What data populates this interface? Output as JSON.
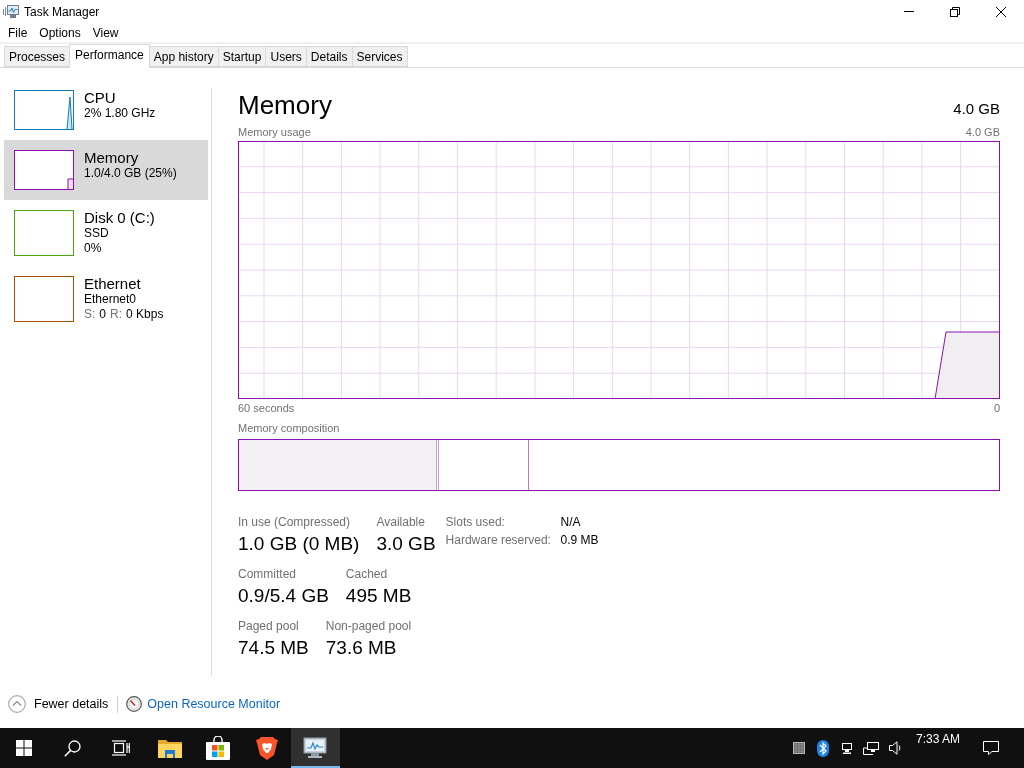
{
  "window": {
    "title": "Task Manager"
  },
  "menu": [
    {
      "label": "File"
    },
    {
      "label": "Options"
    },
    {
      "label": "View"
    }
  ],
  "tabs": [
    {
      "label": "Processes",
      "selected": false
    },
    {
      "label": "Performance",
      "selected": true
    },
    {
      "label": "App history",
      "selected": false
    },
    {
      "label": "Startup",
      "selected": false
    },
    {
      "label": "Users",
      "selected": false
    },
    {
      "label": "Details",
      "selected": false
    },
    {
      "label": "Services",
      "selected": false
    }
  ],
  "sidebar": {
    "items": [
      {
        "kind": "cpu",
        "name": "CPU",
        "details": [
          "2% 1.80 GHz"
        ],
        "color": "#117dbb",
        "selected": false
      },
      {
        "kind": "memory",
        "name": "Memory",
        "details": [
          "1.0/4.0 GB (25%)"
        ],
        "color": "#8b12ae",
        "selected": true
      },
      {
        "kind": "disk",
        "name": "Disk 0 (C:)",
        "details": [
          "SSD",
          "0%"
        ],
        "color": "#4da60c",
        "selected": false
      },
      {
        "kind": "network",
        "name": "Ethernet",
        "details": [
          "Ethernet0"
        ],
        "rates": [
          {
            "label": "S:",
            "value": "0"
          },
          {
            "label": "R:",
            "value": "0 Kbps"
          }
        ],
        "color": "#a74f01",
        "selected": false
      }
    ]
  },
  "panel": {
    "title": "Memory",
    "capacity": "4.0 GB",
    "usage_graph": {
      "label": "Memory usage",
      "max_label": "4.0 GB",
      "start_label": "60 seconds",
      "end_label": "0"
    },
    "composition": {
      "label": "Memory composition"
    },
    "stat_rows": [
      [
        {
          "label": "In use (Compressed)",
          "value": "1.0 GB (0 MB)"
        },
        {
          "label": "Available",
          "value": "3.0 GB"
        }
      ],
      [
        {
          "label": "Committed",
          "value": "0.9/5.4 GB"
        },
        {
          "label": "Cached",
          "value": "495 MB"
        }
      ],
      [
        {
          "label": "Paged pool",
          "value": "74.5 MB"
        },
        {
          "label": "Non-paged pool",
          "value": "73.6 MB"
        }
      ]
    ],
    "details": [
      {
        "label": "Slots used:",
        "value": "N/A"
      },
      {
        "label": "Hardware reserved:",
        "value": "0.9 MB"
      }
    ]
  },
  "footer": {
    "fewer_details": "Fewer details",
    "resource_monitor_link": "Open Resource Monitor"
  },
  "taskbar": {
    "items": [
      {
        "kind": "start",
        "selected": false
      },
      {
        "kind": "search",
        "selected": false
      },
      {
        "kind": "taskview",
        "selected": false
      },
      {
        "kind": "explorer",
        "selected": false
      },
      {
        "kind": "store",
        "selected": false
      },
      {
        "kind": "browser",
        "selected": false
      },
      {
        "kind": "taskmanager",
        "selected": true
      }
    ],
    "clock": {
      "time": "7:33 AM"
    }
  }
}
